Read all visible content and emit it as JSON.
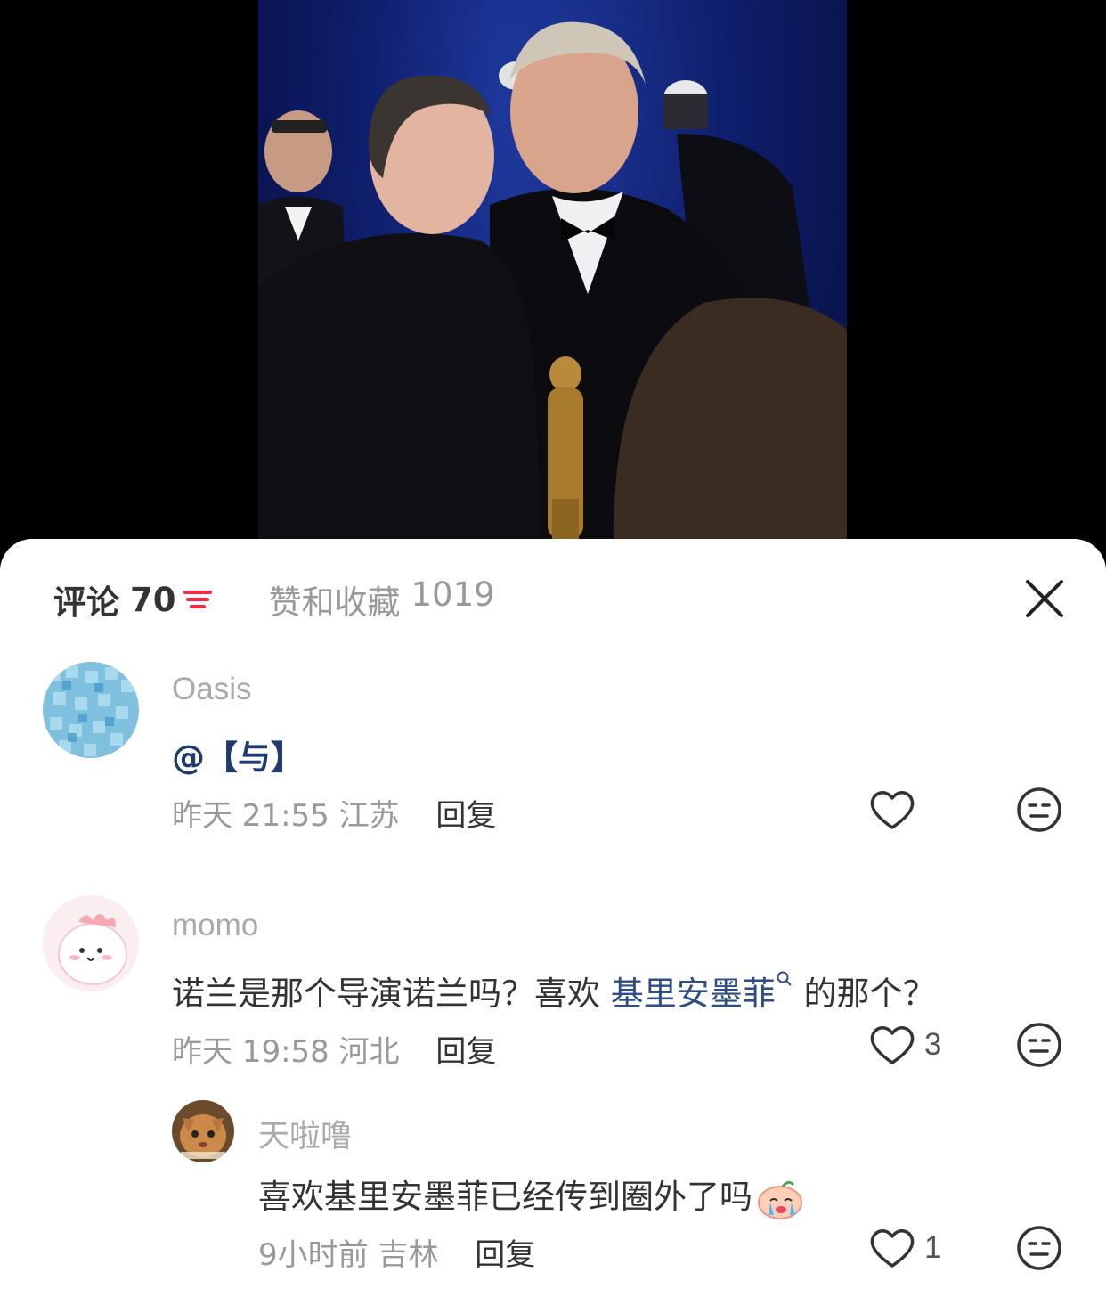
{
  "tabs": {
    "comments_label": "评论",
    "comments_count": "70",
    "likes_label": "赞和收藏",
    "likes_count": "1019"
  },
  "comments": [
    {
      "user": "Oasis",
      "text": "@【与】",
      "time": "昨天 21:55",
      "location": "江苏",
      "reply_label": "回复",
      "likes": ""
    },
    {
      "user": "momo",
      "text_before": "诺兰是那个导演诺兰吗？喜欢",
      "link_text": "基里安墨菲",
      "text_after": "的那个？",
      "time": "昨天 19:58",
      "location": "河北",
      "reply_label": "回复",
      "likes": "3"
    },
    {
      "user": "天啦噜",
      "text": "喜欢基里安墨菲已经传到圈外了吗",
      "time": "9小时前",
      "location": "吉林",
      "reply_label": "回复",
      "likes": "1"
    }
  ],
  "colors": {
    "accent": "#ff2442",
    "link": "#2d4d84",
    "muted": "#999999"
  },
  "icons": [
    "filter-icon",
    "close-icon",
    "heart-icon",
    "meh-face-icon",
    "search-mini-icon",
    "crying-emoji"
  ]
}
